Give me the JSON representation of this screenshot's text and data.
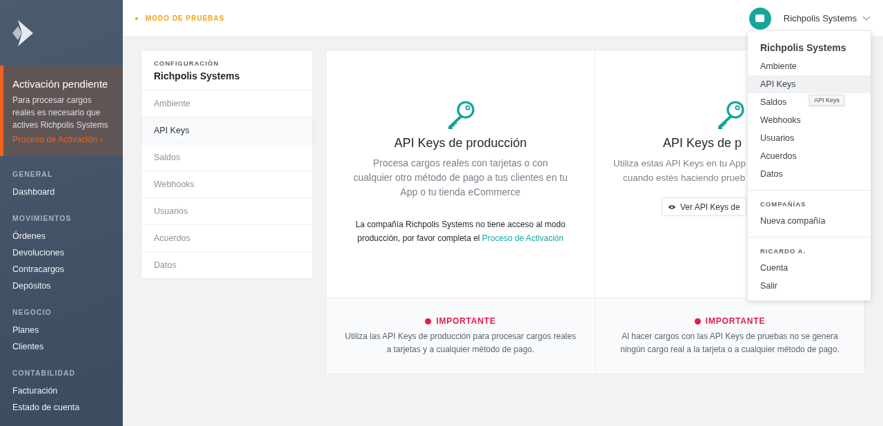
{
  "sidebar": {
    "activation": {
      "title": "Activación pendiente",
      "text": "Para procesar cargos reales es necesario que actives Richpolis Systems",
      "link": "Proceso de Activación ›"
    },
    "sections": [
      {
        "heading": "GENERAL",
        "items": [
          "Dashboard"
        ]
      },
      {
        "heading": "MOVIMIENTOS",
        "items": [
          "Órdenes",
          "Devoluciones",
          "Contracargos",
          "Depósitos"
        ]
      },
      {
        "heading": "NEGOCIO",
        "items": [
          "Planes",
          "Clientes"
        ]
      },
      {
        "heading": "CONTABILIDAD",
        "items": [
          "Facturación",
          "Estado de cuenta"
        ]
      }
    ]
  },
  "topbar": {
    "mode": "MODO DE PRUEBAS",
    "account": "Richpolis Systems"
  },
  "config": {
    "kicker": "CONFIGURACIÓN",
    "title": "Richpolis Systems",
    "items": [
      {
        "label": "Ambiente",
        "selected": false
      },
      {
        "label": "API Keys",
        "selected": true
      },
      {
        "label": "Saldos",
        "selected": false
      },
      {
        "label": "Webhooks",
        "selected": false
      },
      {
        "label": "Usuarios",
        "selected": false
      },
      {
        "label": "Acuerdos",
        "selected": false
      },
      {
        "label": "Datos",
        "selected": false
      }
    ]
  },
  "cards": [
    {
      "kind": "full",
      "title": "API Keys de producción",
      "description": "Procesa cargos reales con tarjetas o con cualquier otro método de pago a tus clientes en tu App o tu tienda eCommerce",
      "notice": "La compañía Richpolis Systems no tiene acceso al modo producción, por favor completa el ",
      "notice_link": "Proceso de Activación",
      "important_label": "IMPORTANTE",
      "important_text": "Utiliza las API Keys de producción para procesar cargos reales a tarjetas y a cualquier método de pago."
    },
    {
      "kind": "partial",
      "title": "API Keys de p",
      "description_lines": [
        "Utiliza estas API Keys en tu App",
        "cuando estés haciendo prueb"
      ],
      "button": "Ver API Keys de",
      "important_label": "IMPORTANTE",
      "important_text": "Al hacer cargos con las API Keys de pruebas no se genera ningún cargo real a la tarjeta o a cualquier método de pago."
    }
  ],
  "dropdown": {
    "title": "Richpolis Systems",
    "items": [
      {
        "label": "Ambiente",
        "selected": false
      },
      {
        "label": "API Keys",
        "selected": true
      },
      {
        "label": "Saldos",
        "selected": false
      },
      {
        "label": "Webhooks",
        "selected": false
      },
      {
        "label": "Usuarios",
        "selected": false
      },
      {
        "label": "Acuerdos",
        "selected": false
      },
      {
        "label": "Datos",
        "selected": false
      }
    ],
    "sections": [
      {
        "heading": "COMPAÑÍAS",
        "items": [
          "Nueva compañía"
        ]
      },
      {
        "heading": "RICARDO A.",
        "items": [
          "Cuenta",
          "Salir"
        ]
      }
    ],
    "tooltip": "API Keys"
  }
}
